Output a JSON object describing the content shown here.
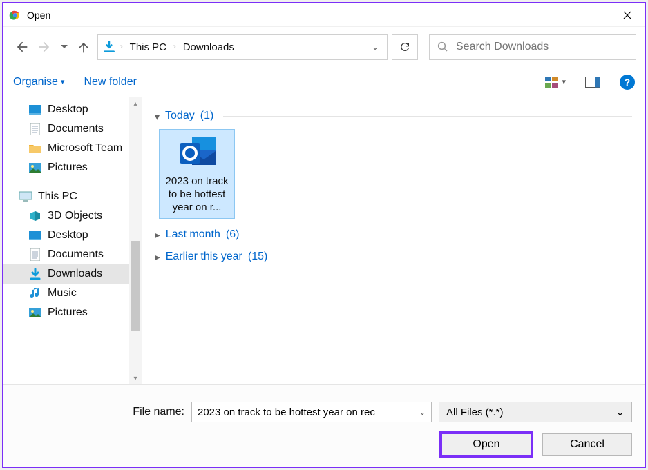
{
  "window": {
    "title": "Open"
  },
  "breadcrumbs": {
    "item1": "This PC",
    "item2": "Downloads"
  },
  "search": {
    "placeholder": "Search Downloads"
  },
  "toolbar": {
    "organise": "Organise",
    "newfolder": "New folder"
  },
  "tree": {
    "desktop1": "Desktop",
    "documents1": "Documents",
    "msteams": "Microsoft Team",
    "pictures1": "Pictures",
    "thispc": "This PC",
    "objects3d": "3D Objects",
    "desktop2": "Desktop",
    "documents2": "Documents",
    "downloads": "Downloads",
    "music": "Music",
    "pictures2": "Pictures"
  },
  "groups": {
    "today": {
      "label": "Today",
      "count": "(1)"
    },
    "lastmonth": {
      "label": "Last month",
      "count": "(6)"
    },
    "earlier": {
      "label": "Earlier this year",
      "count": "(15)"
    }
  },
  "file": {
    "name": "2023 on track to be hottest year on r..."
  },
  "footer": {
    "filename_label": "File name:",
    "filename_value": "2023 on track to be hottest year on rec",
    "filetype": "All Files (*.*)",
    "open": "Open",
    "cancel": "Cancel"
  }
}
